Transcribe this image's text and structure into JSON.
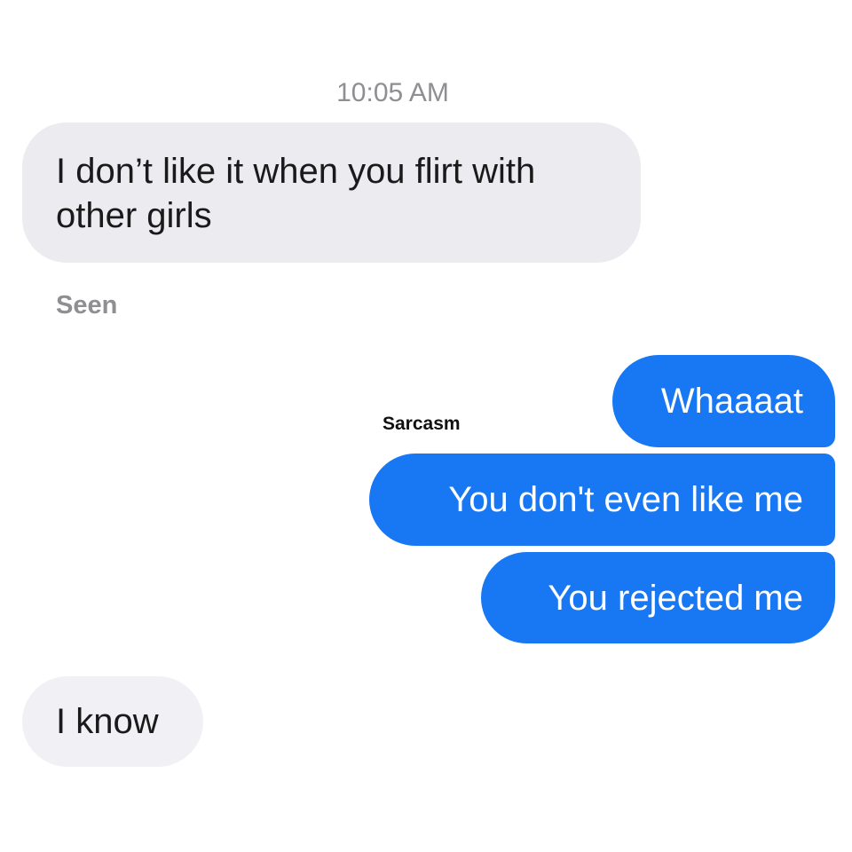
{
  "conversation": {
    "timestamp": "10:05 AM",
    "messages": [
      {
        "direction": "incoming",
        "text": "I don’t like it when you flirt with other girls"
      },
      {
        "direction": "outgoing",
        "text": "Whaaaat"
      },
      {
        "direction": "outgoing",
        "text": "You don't even like me"
      },
      {
        "direction": "outgoing",
        "text": "You rejected me"
      },
      {
        "direction": "incoming",
        "text": "I know"
      }
    ],
    "seen_label": "Seen",
    "annotation": "Sarcasm"
  },
  "colors": {
    "outgoing_bubble": "#1877f2",
    "incoming_bubble": "#ececf0",
    "meta_text": "#8e8e93"
  }
}
